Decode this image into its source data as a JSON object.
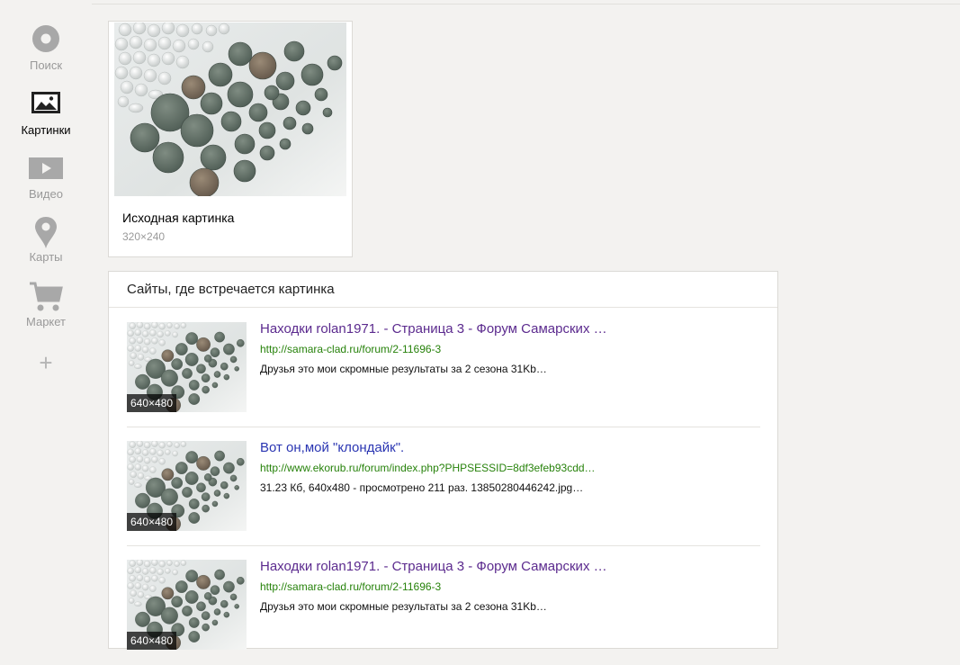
{
  "sidebar": {
    "items": [
      {
        "label": "Поиск",
        "icon": "search-circle-icon"
      },
      {
        "label": "Картинки",
        "icon": "picture-icon",
        "active": true
      },
      {
        "label": "Видео",
        "icon": "video-play-icon"
      },
      {
        "label": "Карты",
        "icon": "map-pin-icon"
      },
      {
        "label": "Маркет",
        "icon": "shopping-cart-icon"
      }
    ],
    "more_label": "+"
  },
  "source": {
    "title": "Исходная картинка",
    "size": "320×240"
  },
  "sites": {
    "header": "Сайты, где встречается картинка",
    "results": [
      {
        "title": "Находки rolan1971. - Страница 3 - Форум Самарских …",
        "url": "http://samara-clad.ru/forum/2-11696-3",
        "desc": "Друзья это мои скромные результаты за 2 сезона 31Kb…",
        "badge": "640×480"
      },
      {
        "title": "Вот он,мой \"клондайк\".",
        "url": "http://www.ekorub.ru/forum/index.php?PHPSESSID=8df3efeb93cdd…",
        "desc": "31.23 Кб, 640x480 - просмотрено 211 раз. 13850280446242.jpg…",
        "badge": "640×480"
      },
      {
        "title": "Находки rolan1971. - Страница 3 - Форум Самарских …",
        "url": "http://samara-clad.ru/forum/2-11696-3",
        "desc": "Друзья это мои скромные результаты за 2 сезона 31Kb…",
        "badge": "640×480"
      }
    ]
  },
  "colors": {
    "visited_link": "#5b2a8e",
    "link": "#2a35b2",
    "url_green": "#27820b",
    "icon_gray": "#a8a8a8"
  }
}
